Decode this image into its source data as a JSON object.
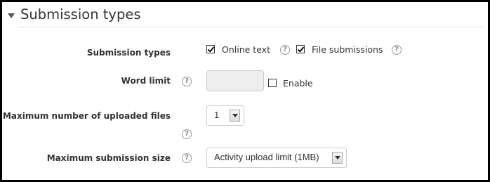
{
  "section": {
    "title": "Submission types"
  },
  "fields": {
    "submission_types": {
      "label": "Submission types",
      "options": [
        {
          "label": "Online text",
          "checked": true
        },
        {
          "label": "File submissions",
          "checked": true
        }
      ]
    },
    "word_limit": {
      "label": "Word limit",
      "value": "",
      "enable_label": "Enable",
      "enable_checked": false
    },
    "max_files": {
      "label": "Maximum number of uploaded files",
      "value": "1"
    },
    "max_size": {
      "label": "Maximum submission size",
      "value": "Activity upload limit (1MB)"
    }
  },
  "help_icon_glyph": "?"
}
